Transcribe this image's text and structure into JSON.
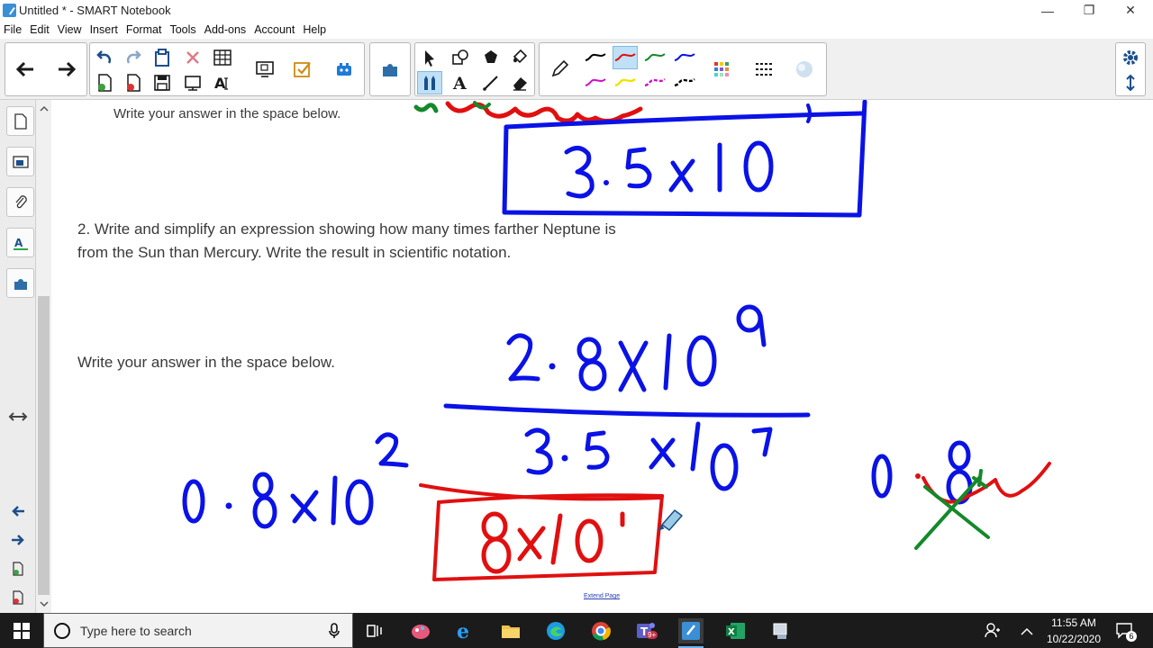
{
  "window": {
    "title": "Untitled * - SMART Notebook",
    "minimize_glyph": "—",
    "restore_glyph": "❐",
    "close_glyph": "✕"
  },
  "menu": [
    "File",
    "Edit",
    "View",
    "Insert",
    "Format",
    "Tools",
    "Add-ons",
    "Account",
    "Help"
  ],
  "page": {
    "prompt_top": "Write your answer in the space below.",
    "question_2_line1": "2. Write and simplify an expression showing how many times farther Neptune is",
    "question_2_line2": "from the Sun than Mercury. Write the result in scientific notation.",
    "prompt_bottom": "Write your answer in the space below.",
    "extend_page": "Extend Page"
  },
  "colors": {
    "ink_blue": "#0a12e6",
    "ink_red": "#e01010",
    "ink_green": "#14892a",
    "accent": "#1f7ad6"
  },
  "taskbar": {
    "search_placeholder": "Type here to search",
    "time": "11:55 AM",
    "date": "10/22/2020",
    "notification_count": "6",
    "teams_badge": "9+"
  }
}
